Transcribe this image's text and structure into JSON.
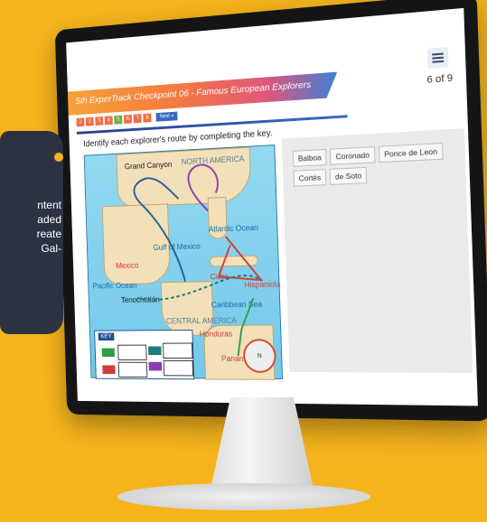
{
  "screen": {
    "title": "5th ExperTrack Checkpoint 06 - Famous European Explorers",
    "page_indicator": "6 of 9",
    "steps": [
      "1",
      "2",
      "3",
      "4",
      "5",
      "6",
      "7",
      "8"
    ],
    "next_label": "Next »",
    "instructions": "Identify each explorer's route by completing the key."
  },
  "map": {
    "labels": [
      "Grand Canyon",
      "NORTH AMERICA",
      "Atlantic Ocean",
      "Gulf of Mexico",
      "Mexico",
      "Pacific Ocean",
      "Tenochtitlán",
      "Cuba",
      "Hispaniola",
      "Caribbean Sea",
      "CENTRAL AMERICA",
      "Honduras",
      "Panama"
    ],
    "key_title": "KEY",
    "compass": "N"
  },
  "answer_bank": {
    "tiles": [
      "Balboa",
      "Coronado",
      "Ponce de Leon",
      "Cortés",
      "de Soto"
    ]
  },
  "overlay": {
    "lines": [
      "ntent",
      "aded",
      "reate",
      "Gal-"
    ]
  }
}
